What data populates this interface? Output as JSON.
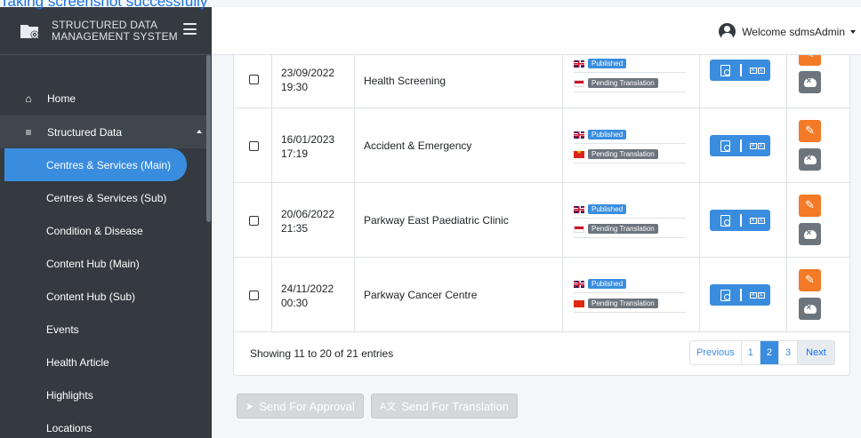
{
  "banner": {
    "text": "Taking screenshot successfully"
  },
  "brand": {
    "line1": "STRUCTURED DATA",
    "line2": "MANAGEMENT SYSTEM"
  },
  "header": {
    "welcome": "Welcome sdmsAdmin"
  },
  "sidebar": {
    "items": [
      {
        "label": "Home",
        "icon": "home-icon"
      },
      {
        "label": "Structured Data",
        "icon": "database-icon"
      },
      {
        "label": "Centres & Services (Main)"
      },
      {
        "label": "Centres & Services (Sub)"
      },
      {
        "label": "Condition & Disease"
      },
      {
        "label": "Content Hub (Main)"
      },
      {
        "label": "Content Hub (Sub)"
      },
      {
        "label": "Events"
      },
      {
        "label": "Health Article"
      },
      {
        "label": "Highlights"
      },
      {
        "label": "Locations"
      }
    ]
  },
  "table": {
    "rows": [
      {
        "date": "23/09/2022",
        "time": "19:30",
        "name": "Health Screening",
        "status_1": "Published",
        "status_2": "Pending Translation",
        "flag_2": "indonesia"
      },
      {
        "date": "16/01/2023",
        "time": "17:19",
        "name": "Accident & Emergency",
        "status_1": "Published",
        "status_2": "Pending Translation",
        "flag_2": "vietnam"
      },
      {
        "date": "20/06/2022",
        "time": "21:35",
        "name": "Parkway East Paediatric Clinic",
        "status_1": "Published",
        "status_2": "Pending Translation",
        "flag_2": "indonesia"
      },
      {
        "date": "24/11/2022",
        "time": "00:30",
        "name": "Parkway Cancer Centre",
        "status_1": "Published",
        "status_2": "Pending Translation",
        "flag_2": "china"
      }
    ],
    "info": "Showing 11 to 20 of 21 entries"
  },
  "pagination": {
    "previous": "Previous",
    "pages": [
      "1",
      "2",
      "3"
    ],
    "current": "2",
    "next": "Next"
  },
  "actions": {
    "send_approval": "Send For Approval",
    "send_translation": "Send For Translation"
  },
  "colors": {
    "sidebar_bg": "#343a40",
    "accent_blue": "#3a8dde",
    "edit_orange": "#f37a26",
    "delete_gray": "#6c757d"
  }
}
